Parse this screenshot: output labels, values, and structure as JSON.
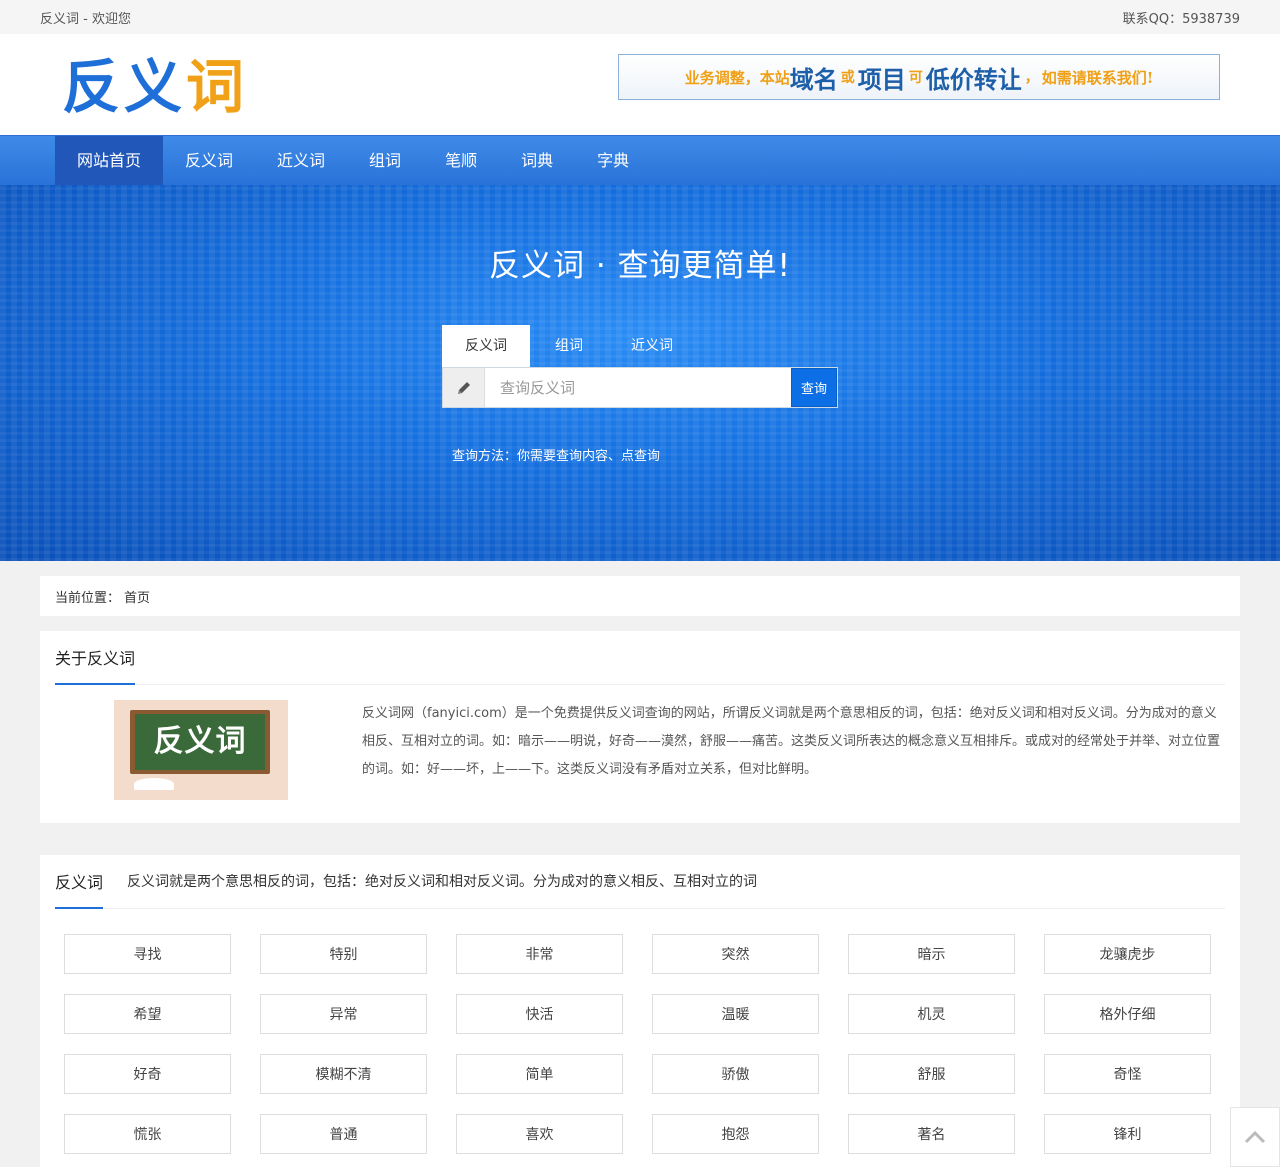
{
  "topbar": {
    "welcome": "反义词 - 欢迎您",
    "contact": "联系QQ：5938739"
  },
  "logo": {
    "part1": "反义",
    "part2": "词"
  },
  "banner": {
    "segments": [
      "业务调整，本站",
      "域名",
      "或",
      "项目",
      "可",
      "低价转让",
      "，",
      "如需请联系我们!"
    ]
  },
  "nav": [
    "网站首页",
    "反义词",
    "近义词",
    "组词",
    "笔顺",
    "词典",
    "字典"
  ],
  "hero": {
    "title": "反义词 · 查询更简单!",
    "tabs": [
      "反义词",
      "组词",
      "近义词"
    ],
    "search_placeholder": "查询反义词",
    "search_button": "查询",
    "hint": "查询方法：你需要查询内容、点查询"
  },
  "breadcrumb": {
    "label": "当前位置：",
    "current": "首页"
  },
  "about": {
    "title": "关于反义词",
    "image_text": "反义词",
    "text": "反义词网（fanyici.com）是一个免费提供反义词查询的网站，所谓反义词就是两个意思相反的词，包括：绝对反义词和相对反义词。分为成对的意义相反、互相对立的词。如：暗示——明说，好奇——漠然，舒服——痛苦。这类反义词所表达的概念意义互相排斥。或成对的经常处于并举、对立位置的词。如：好——坏，上——下。这类反义词没有矛盾对立关系，但对比鲜明。"
  },
  "words": {
    "title": "反义词",
    "desc": "反义词就是两个意思相反的词，包括：绝对反义词和相对反义词。分为成对的意义相反、互相对立的词",
    "items": [
      "寻找",
      "特别",
      "非常",
      "突然",
      "暗示",
      "龙骧虎步",
      "希望",
      "异常",
      "快活",
      "温暖",
      "机灵",
      "格外仔细",
      "好奇",
      "模糊不清",
      "简单",
      "骄傲",
      "舒服",
      "奇怪",
      "慌张",
      "普通",
      "喜欢",
      "抱怨",
      "著名",
      "锋利"
    ]
  },
  "colors": {
    "brand_blue": "#1f6fd8",
    "brand_orange": "#f1a118",
    "nav_active": "#2157b8",
    "button_blue": "#0d6fe6"
  },
  "icons": {
    "search_prefix": "pencil-icon",
    "back_to_top": "chevron-up-icon"
  }
}
